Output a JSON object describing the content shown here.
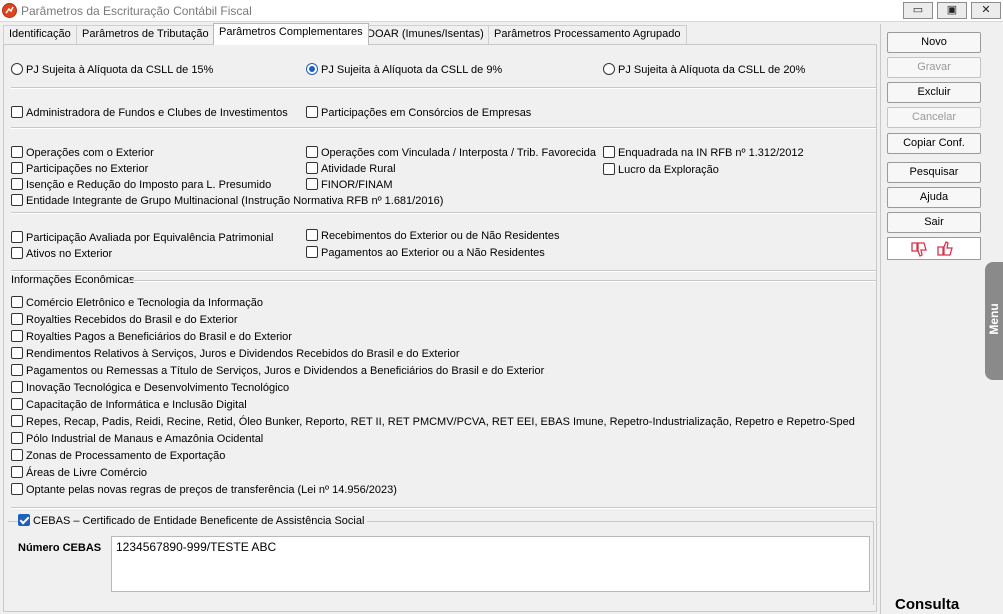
{
  "window": {
    "title": "Parâmetros da Escrituração Contábil Fiscal",
    "minimize": "▭",
    "maximize": "▣",
    "close": "✕"
  },
  "tabs": [
    "Identificação",
    "Parâmetros de Tributação",
    "Parâmetros Complementares",
    "DOAR (Imunes/Isentas)",
    "Parâmetros Processamento Agrupado"
  ],
  "active_tab": "Parâmetros Complementares",
  "csll_radios": [
    {
      "label": "PJ Sujeita à Alíquota da CSLL de 15%",
      "checked": false
    },
    {
      "label": "PJ Sujeita à Alíquota da CSLL de 9%",
      "checked": true
    },
    {
      "label": "PJ Sujeita à Alíquota da CSLL de 20%",
      "checked": false
    }
  ],
  "group1": [
    "Administradora de Fundos e Clubes de Investimentos",
    "Participações em Consórcios de Empresas"
  ],
  "group2": [
    "Operações com o Exterior",
    "Participações no Exterior",
    "Isenção e Redução do Imposto para L. Presumido",
    "Entidade Integrante de Grupo Multinacional (Instrução Normativa RFB nº 1.681/2016)",
    "Operações com Vinculada / Interposta / Trib. Favorecida",
    "Atividade Rural",
    "FINOR/FINAM",
    "Enquadrada na IN RFB nº 1.312/2012",
    "Lucro da Exploração"
  ],
  "group3": [
    "Participação Avaliada por Equivalência Patrimonial",
    "Ativos no Exterior",
    "Recebimentos do Exterior ou de Não Residentes",
    "Pagamentos ao Exterior ou a Não Residentes"
  ],
  "econ": {
    "title": "Informações Econômicas",
    "items": [
      "Comércio Eletrônico e Tecnologia da Informação",
      "Royalties Recebidos do Brasil e do Exterior",
      "Royalties Pagos a Beneficiários do Brasil e do Exterior",
      "Rendimentos Relativos à Serviços, Juros e Dividendos Recebidos do Brasil e do Exterior",
      "Pagamentos ou Remessas a Título de Serviços, Juros e Dividendos a Beneficiários do Brasil e do Exterior",
      "Inovação Tecnológica e Desenvolvimento Tecnológico",
      "Capacitação de Informática e Inclusão Digital",
      "Repes, Recap, Padis, Reidi, Recine, Retid, Óleo Bunker, Reporto, RET II, RET PMCMV/PCVA, RET EEI, EBAS Imune, Repetro-Industrialização, Repetro e Repetro-Sped",
      "Pólo Industrial de Manaus e Amazônia Ocidental",
      "Zonas de Processamento de Exportação",
      "Áreas de Livre Comércio",
      "Optante pelas novas regras de preços de transferência (Lei nº 14.956/2023)"
    ]
  },
  "cebas": {
    "label": "CEBAS – Certificado de Entidade Beneficente de Assistência Social",
    "checked": true,
    "field_label": "Número CEBAS",
    "field_value": "1234567890-999/TESTE ABC"
  },
  "side_buttons": [
    {
      "label": "Novo",
      "ul": "N",
      "enabled": true
    },
    {
      "label": "Gravar",
      "ul": "G",
      "enabled": false
    },
    {
      "label": "Excluir",
      "ul": "E",
      "enabled": true
    },
    {
      "label": "Cancelar",
      "ul": "C",
      "enabled": false
    },
    {
      "label": "Copiar Conf.",
      "ul": "f",
      "enabled": true
    },
    {
      "label": "Pesquisar",
      "ul": "q",
      "enabled": true
    },
    {
      "label": "Ajuda",
      "ul": "j",
      "enabled": true
    },
    {
      "label": "Sair",
      "ul": "S",
      "enabled": true
    }
  ],
  "status": "Consulta",
  "menu_tab": "Menu",
  "colors": {
    "accent": "#1f5fbf",
    "thumbs": "#d9334a"
  },
  "icons": [
    "app-icon",
    "thumbs-down-icon",
    "thumbs-up-icon"
  ]
}
